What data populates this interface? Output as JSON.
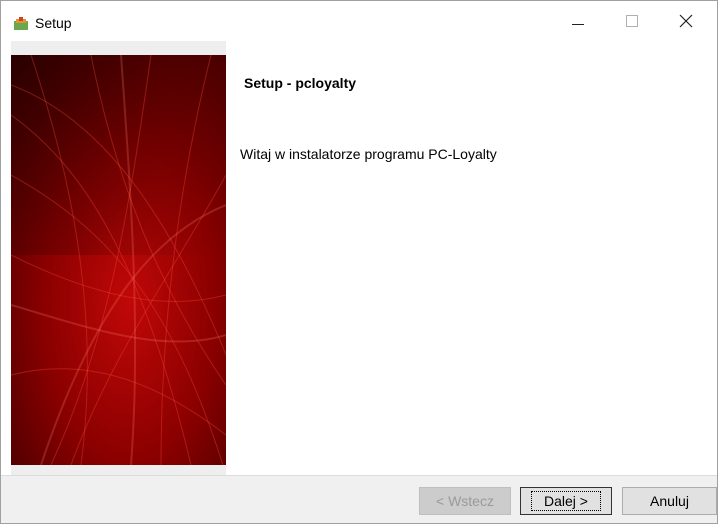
{
  "window": {
    "title": "Setup",
    "controls": {
      "minimize": "—",
      "maximize": "☐",
      "close": "✕"
    }
  },
  "page": {
    "heading": "Setup - pcloyalty",
    "message": "Witaj w instalatorze programu PC-Loyalty"
  },
  "buttons": {
    "back": "< Wstecz",
    "next": "Dalej >",
    "cancel": "Anuluj"
  },
  "colors": {
    "banner_dark": "#5a0000",
    "banner_bright": "#d01010",
    "footer_bg": "#f0f0f0"
  },
  "icons": {
    "app": "setup-app-icon"
  }
}
